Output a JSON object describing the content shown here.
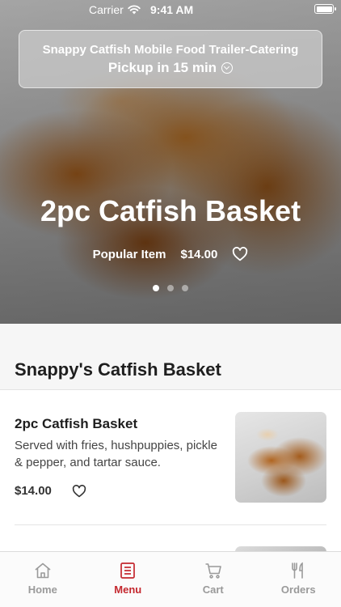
{
  "status_bar": {
    "carrier": "Carrier",
    "time": "9:41 AM",
    "battery_level": 1.0
  },
  "header": {
    "restaurant_name": "Snappy Catfish Mobile Food Trailer-Catering",
    "pickup_text": "Pickup in 15 min"
  },
  "hero": {
    "title": "2pc Catfish Basket",
    "badge": "Popular Item",
    "price": "$14.00",
    "carousel_dots": 3,
    "active_dot": 0
  },
  "section": {
    "title": "Snappy's Catfish Basket"
  },
  "items": [
    {
      "name": "2pc Catfish Basket",
      "description": "Served with fries, hushpuppies, pickle & pepper, and tartar sauce.",
      "price": "$14.00"
    }
  ],
  "tabs": [
    {
      "label": "Home",
      "icon": "home-icon",
      "active": false
    },
    {
      "label": "Menu",
      "icon": "menu-icon",
      "active": true
    },
    {
      "label": "Cart",
      "icon": "cart-icon",
      "active": false
    },
    {
      "label": "Orders",
      "icon": "utensils-icon",
      "active": false
    }
  ],
  "colors": {
    "accent": "#c4272e",
    "tab_inactive": "#9a9a9a"
  }
}
